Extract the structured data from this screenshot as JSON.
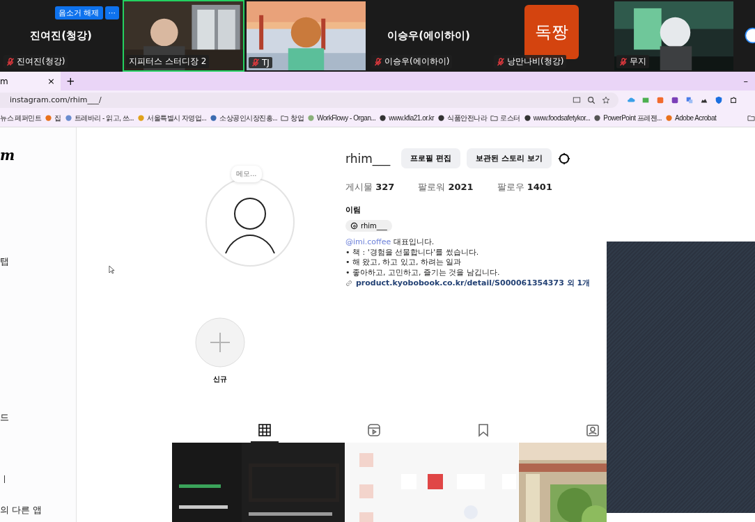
{
  "meeting": {
    "tiles": [
      {
        "kind": "name",
        "display_name": "진여진(청강)",
        "label": "진여진(청강)",
        "muted": true,
        "speaking": false,
        "buttons": [
          "음소거 해제",
          "···"
        ]
      },
      {
        "kind": "video",
        "label": "지피터스 스터디장 2",
        "muted": false,
        "speaking": true
      },
      {
        "kind": "video",
        "label": "TJ",
        "muted": true,
        "speaking": false
      },
      {
        "kind": "name",
        "display_name": "이승우(에이하이)",
        "label": "이승우(에이하이)",
        "muted": true,
        "speaking": false
      },
      {
        "kind": "avatar",
        "avatar_text": "독짱",
        "label": "낭만나비(청강)",
        "muted": true,
        "speaking": false
      },
      {
        "kind": "video",
        "label": "무지",
        "muted": true,
        "speaking": false
      }
    ]
  },
  "browser": {
    "tab": {
      "title": "m",
      "close": "×"
    },
    "new_tab": "+",
    "minimize": "–",
    "address": "instagram.com/rhim___/",
    "bookmarks": [
      {
        "kind": "text",
        "label": "뉴스 페퍼민트"
      },
      {
        "kind": "site",
        "label": "집"
      },
      {
        "kind": "site",
        "label": "트레바리 - 읽고, 쓰..."
      },
      {
        "kind": "site",
        "label": "서울특별시 자영업..."
      },
      {
        "kind": "site",
        "label": "소상공인시장진흥..."
      },
      {
        "kind": "folder",
        "label": "창업"
      },
      {
        "kind": "site",
        "label": "WorkFlowy - Organ..."
      },
      {
        "kind": "site",
        "label": "www.kfia21.or.kr"
      },
      {
        "kind": "site",
        "label": "식품안전나라"
      },
      {
        "kind": "folder",
        "label": "로스터"
      },
      {
        "kind": "site",
        "label": "www.foodsafetykor..."
      },
      {
        "kind": "site",
        "label": "PowerPoint 프레젠..."
      },
      {
        "kind": "site",
        "label": "Adobe Acrobat"
      }
    ]
  },
  "sidebar": {
    "logo": "m",
    "items": [
      "탭",
      "드",
      "ㅣ",
      "의 다른 앱"
    ]
  },
  "profile": {
    "memo": "메모...",
    "username": "rhim___",
    "buttons": [
      "프로필 편집",
      "보관된 스토리 보기"
    ],
    "stats": [
      {
        "label": "게시물",
        "value": "327"
      },
      {
        "label": "팔로워",
        "value": "2021"
      },
      {
        "label": "팔로우",
        "value": "1401"
      }
    ],
    "name": "이림",
    "threads": "rhim___",
    "bio": {
      "mention": "@imi.coffee",
      "first": " 대표입니다.",
      "lines": [
        "• 책 : '경험을 선물합니다'를 썼습니다.",
        "• 해 왔고, 하고 있고, 하려는 일과",
        "• 좋아하고, 고민하고, 즐기는 것을 남깁니다."
      ]
    },
    "link": "product.kyobobook.co.kr/detail/S000061354373",
    "link_more": "외 1개"
  },
  "highlights": [
    {
      "label": "신규"
    }
  ],
  "tabs": [
    {
      "kind": "posts",
      "selected": true
    },
    {
      "kind": "reels",
      "selected": false
    },
    {
      "kind": "saved",
      "selected": false
    },
    {
      "kind": "tagged",
      "selected": false
    }
  ]
}
